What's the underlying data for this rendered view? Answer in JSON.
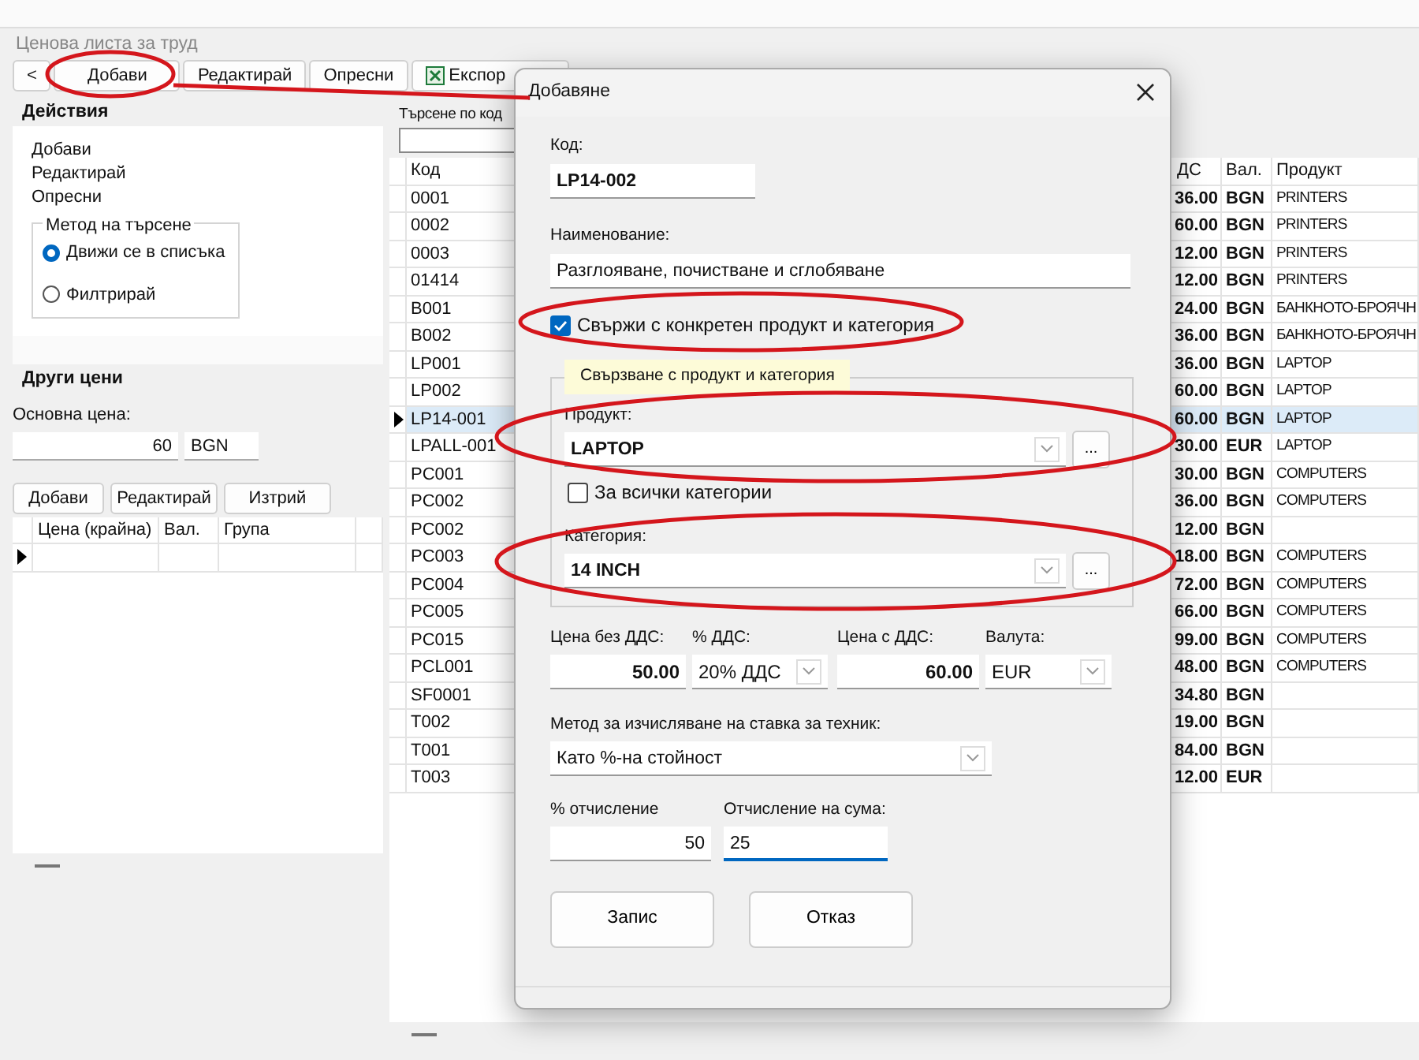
{
  "window": {
    "title": "Ценова листа за труд"
  },
  "toolbar": {
    "buttons": [
      {
        "label": "<",
        "kind": "plain"
      },
      {
        "label": "Добави",
        "kind": "plain"
      },
      {
        "label": "Редактирай",
        "kind": "plain"
      },
      {
        "label": "Опресни",
        "kind": "plain"
      },
      {
        "label": "Експор",
        "kind": "excel"
      }
    ]
  },
  "actions": {
    "title": "Действия",
    "links": [
      "Добави",
      "Редактирай",
      "Опресни"
    ],
    "search_method": {
      "title": "Метод на търсене",
      "options": [
        {
          "label": "Движи се в списъка",
          "selected": true
        },
        {
          "label": "Филтрирай",
          "selected": false
        }
      ]
    }
  },
  "other_prices": {
    "title": "Други цени",
    "base_price_label": "Основна цена:",
    "base_price": "60",
    "base_currency": "BGN",
    "buttons": [
      "Добави",
      "Редактирай",
      "Изтрий"
    ],
    "columns": [
      "Цена (крайна)",
      "Вал.",
      "Група"
    ]
  },
  "list": {
    "search_label": "Търсене по код",
    "columns": [
      "Код",
      "ДС",
      "Вал.",
      "Продукт"
    ],
    "rows": [
      {
        "code": "0001",
        "price": "36.00",
        "currency": "BGN",
        "product": "PRINTERS",
        "selected": false
      },
      {
        "code": "0002",
        "price": "60.00",
        "currency": "BGN",
        "product": "PRINTERS",
        "selected": false
      },
      {
        "code": "0003",
        "price": "12.00",
        "currency": "BGN",
        "product": "PRINTERS",
        "selected": false
      },
      {
        "code": "01414",
        "price": "12.00",
        "currency": "BGN",
        "product": "PRINTERS",
        "selected": false
      },
      {
        "code": "B001",
        "price": "24.00",
        "currency": "BGN",
        "product": "БАНКНОТО-БРОЯЧН",
        "selected": false
      },
      {
        "code": "B002",
        "price": "36.00",
        "currency": "BGN",
        "product": "БАНКНОТО-БРОЯЧН",
        "selected": false
      },
      {
        "code": "LP001",
        "price": "36.00",
        "currency": "BGN",
        "product": "LAPTOP",
        "selected": false
      },
      {
        "code": "LP002",
        "price": "60.00",
        "currency": "BGN",
        "product": "LAPTOP",
        "selected": false
      },
      {
        "code": "LP14-001",
        "price": "60.00",
        "currency": "BGN",
        "product": "LAPTOP",
        "selected": true
      },
      {
        "code": "LPALL-001",
        "price": "30.00",
        "currency": "EUR",
        "product": "LAPTOP",
        "selected": false
      },
      {
        "code": "PC001",
        "price": "30.00",
        "currency": "BGN",
        "product": "COMPUTERS",
        "selected": false
      },
      {
        "code": "PC002",
        "price": "36.00",
        "currency": "BGN",
        "product": "COMPUTERS",
        "selected": false
      },
      {
        "code": "PC002",
        "price": "12.00",
        "currency": "BGN",
        "selected": false
      },
      {
        "code": "PC003",
        "price": "18.00",
        "currency": "BGN",
        "product": "COMPUTERS",
        "selected": false
      },
      {
        "code": "PC004",
        "price": "72.00",
        "currency": "BGN",
        "product": "COMPUTERS",
        "selected": false
      },
      {
        "code": "PC005",
        "price": "66.00",
        "currency": "BGN",
        "product": "COMPUTERS",
        "selected": false
      },
      {
        "code": "PC015",
        "price": "99.00",
        "currency": "BGN",
        "product": "COMPUTERS",
        "selected": false
      },
      {
        "code": "PCL001",
        "price": "48.00",
        "currency": "BGN",
        "product": "COMPUTERS",
        "selected": false
      },
      {
        "code": "SF0001",
        "price": "34.80",
        "currency": "BGN",
        "selected": false
      },
      {
        "code": "T002",
        "price": "19.00",
        "currency": "BGN",
        "selected": false
      },
      {
        "code": "T001",
        "price": "84.00",
        "currency": "BGN",
        "selected": false
      },
      {
        "code": "T003",
        "price": "12.00",
        "currency": "EUR",
        "selected": false
      }
    ]
  },
  "dialog": {
    "title": "Добавяне",
    "code_label": "Код:",
    "code": "LP14-002",
    "name_label": "Наименование:",
    "name": "Разглояване, почистване и сглобяване",
    "link_checkbox": {
      "label": "Свържи с конкретен продукт и категория",
      "checked": true
    },
    "link_group": {
      "title": "Свързване с продукт и категория",
      "product_label": "Продукт:",
      "product": "LAPTOP",
      "all_categories": {
        "label": "За всички категории",
        "checked": false
      },
      "category_label": "Категория:",
      "category": "14 INCH",
      "browse_button": "..."
    },
    "price_net_label": "Цена без ДДС:",
    "price_net": "50.00",
    "vat_label": "% ДДС:",
    "vat": "20% ДДС",
    "price_gross_label": "Цена с ДДС:",
    "price_gross": "60.00",
    "currency_label": "Валута:",
    "currency": "EUR",
    "method_label": "Метод за изчисляване на ставка за техник:",
    "method": "Като %-на стойност",
    "percent_label": "% отчисление",
    "percent": "50",
    "amount_label": "Отчисление на сума:",
    "amount": "25",
    "buttons": [
      "Запис",
      "Отказ"
    ]
  }
}
